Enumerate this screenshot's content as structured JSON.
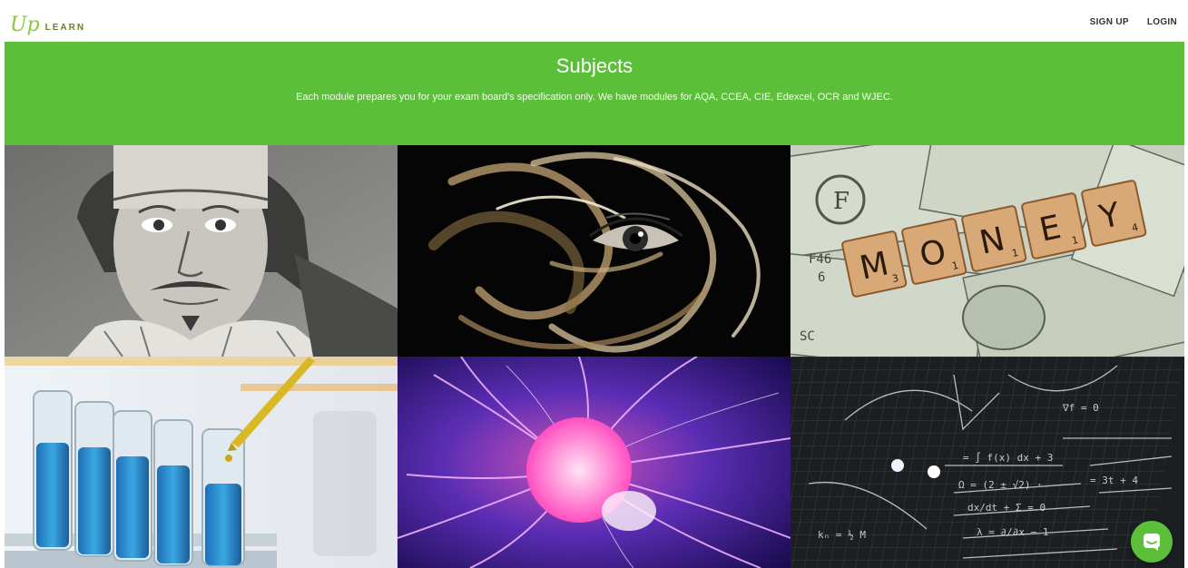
{
  "header": {
    "logo_mark": "Up",
    "logo_text": "LEARN",
    "nav": [
      {
        "label": "SIGN UP"
      },
      {
        "label": "LOGIN"
      }
    ]
  },
  "banner": {
    "title": "Subjects",
    "subtitle": "Each module prepares you for your exam board's specification only. We have modules for AQA, CCEA, CIE, Edexcel, OCR and WJEC."
  },
  "tiles": [
    {
      "subject_image": "shakespeare-engraving"
    },
    {
      "subject_image": "eye-in-smoke"
    },
    {
      "subject_image": "money-scrabble-tiles"
    },
    {
      "subject_image": "test-tubes-pipette"
    },
    {
      "subject_image": "plasma-ball"
    },
    {
      "subject_image": "maths-equations-blackboard"
    }
  ],
  "money_tiles": [
    {
      "letter": "M",
      "score": "3"
    },
    {
      "letter": "O",
      "score": "1"
    },
    {
      "letter": "N",
      "score": "1"
    },
    {
      "letter": "E",
      "score": "1"
    },
    {
      "letter": "Y",
      "score": "4"
    }
  ],
  "colors": {
    "brand_green": "#5bbf3a",
    "logo_green": "#8dc63f"
  },
  "chat": {
    "icon": "chat-icon"
  }
}
